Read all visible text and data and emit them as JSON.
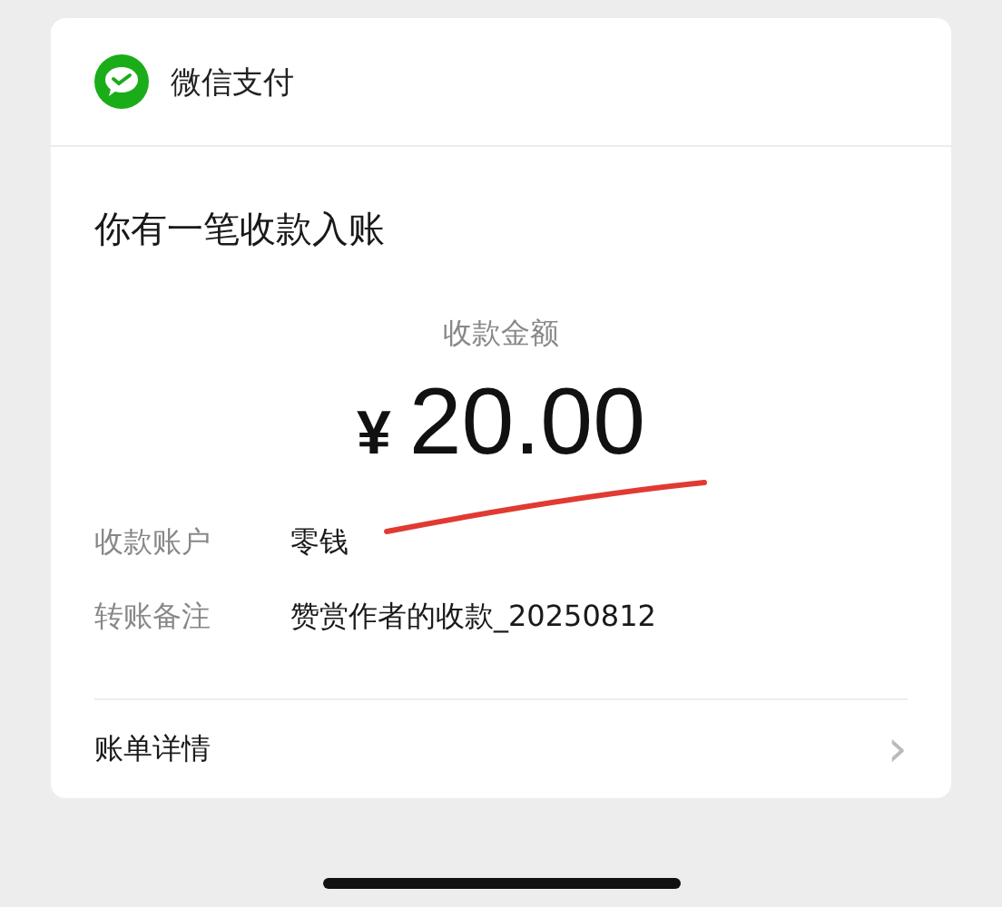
{
  "header": {
    "title": "微信支付"
  },
  "notice": {
    "title": "你有一笔收款入账",
    "amount_label": "收款金额",
    "currency": "¥",
    "amount": "20.00"
  },
  "details": [
    {
      "label": "收款账户",
      "value": "零钱"
    },
    {
      "label": "转账备注",
      "value": "赞赏作者的收款_20250812"
    }
  ],
  "footer": {
    "link": "账单详情",
    "chevron": "›"
  }
}
